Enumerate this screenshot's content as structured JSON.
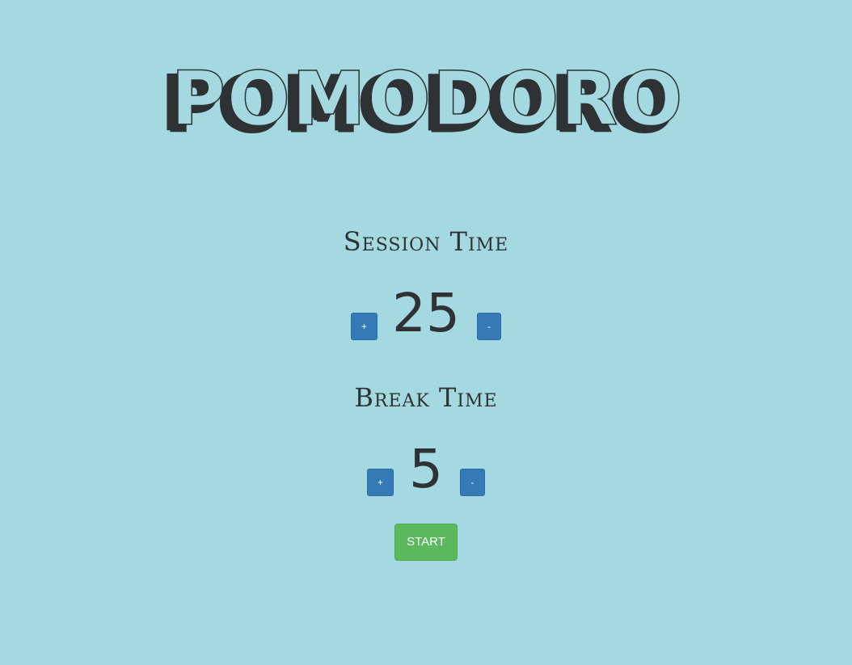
{
  "app": {
    "title": "POMODORO"
  },
  "session": {
    "label": "Session Time",
    "value": "25",
    "increment_label": "+",
    "decrement_label": "-"
  },
  "break": {
    "label": "Break Time",
    "value": "5",
    "increment_label": "+",
    "decrement_label": "-"
  },
  "controls": {
    "start_label": "START"
  },
  "colors": {
    "background": "#a4d9e2",
    "text": "#2f3235",
    "primary_button": "#337ab7",
    "start_button": "#5cb85c"
  }
}
